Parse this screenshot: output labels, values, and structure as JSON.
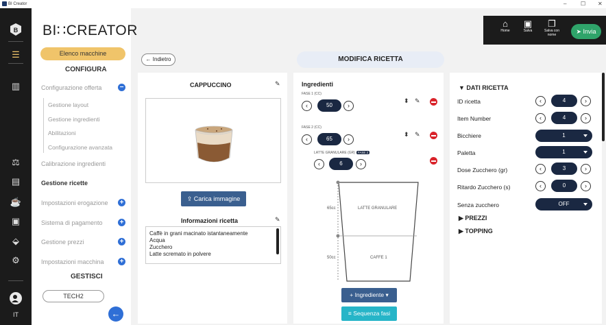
{
  "window": {
    "title": "BI Creator",
    "min": "–",
    "max": "☐",
    "close": "✕"
  },
  "rail": {
    "lang": "IT"
  },
  "brand": "BI∷CREATOR",
  "menu": {
    "elenco": "Elenco macchine",
    "configura": "CONFIGURA",
    "config_offerta": "Configurazione offerta",
    "sub": [
      "Gestione layout",
      "Gestione ingredienti",
      "Abilitazioni",
      "Configurazione avanzata"
    ],
    "calibrazione": "Calibrazione ingredienti",
    "gestione_ricette": "Gestione ricette",
    "impostazioni_erogazione": "Impostazioni erogazione",
    "sistema_pagamento": "Sistema di pagamento",
    "gestione_prezzi": "Gestione prezzi",
    "impostazioni_macchina": "Impostazioni macchina",
    "gestisci": "GESTISCI",
    "tech": "TECH2"
  },
  "toolbar": {
    "home": "Home",
    "salva": "Salva",
    "salva_nome": "Salva con nome",
    "invia": "Invia"
  },
  "header": {
    "back": "Indietro",
    "title": "MODIFICA RICETTA"
  },
  "left": {
    "name": "CAPPUCCINO",
    "carica": "Carica immagine",
    "info_title": "Informazioni ricetta",
    "info_lines": [
      "Caffè in grani macinato istantaneamente",
      "Acqua",
      "Zucchero",
      "Latte scremato in  polvere"
    ]
  },
  "ingredients": {
    "title": "Ingredienti",
    "fase1_label": "FASE 1 (CC)",
    "fase1_value": "50",
    "fase2_label": "FASE 2 (CC)",
    "fase2_value": "65",
    "latte_label": "LATTE GRANULARE (GR)",
    "latte_badge": "FASE 2",
    "latte_value": "6",
    "cup_top_cc": "65cc",
    "cup_top_name": "LATTE GRANULARE",
    "cup_bottom_cc": "50cc",
    "cup_bottom_name": "CAFFE 1",
    "add_btn": "Ingrediente",
    "seq_btn": "Sequenza fasi"
  },
  "dati": {
    "title": "DATI RICETTA",
    "id_label": "ID ricetta",
    "id_value": "4",
    "item_label": "Item Number",
    "item_value": "4",
    "bicchiere_label": "Bicchiere",
    "bicchiere_value": "1",
    "paletta_label": "Paletta",
    "paletta_value": "1",
    "dose_label": "Dose Zucchero (gr)",
    "dose_value": "3",
    "ritardo_label": "Ritardo Zucchero (s)",
    "ritardo_value": "0",
    "senza_label": "Senza zucchero",
    "senza_value": "OFF",
    "prezzi": "PREZZI",
    "topping": "TOPPING"
  },
  "colors": {
    "accent": "#2f6fd6",
    "navy": "#1a2842",
    "elenco": "#f0c46a",
    "invia": "#2fa46a",
    "remove": "#d9232a"
  }
}
